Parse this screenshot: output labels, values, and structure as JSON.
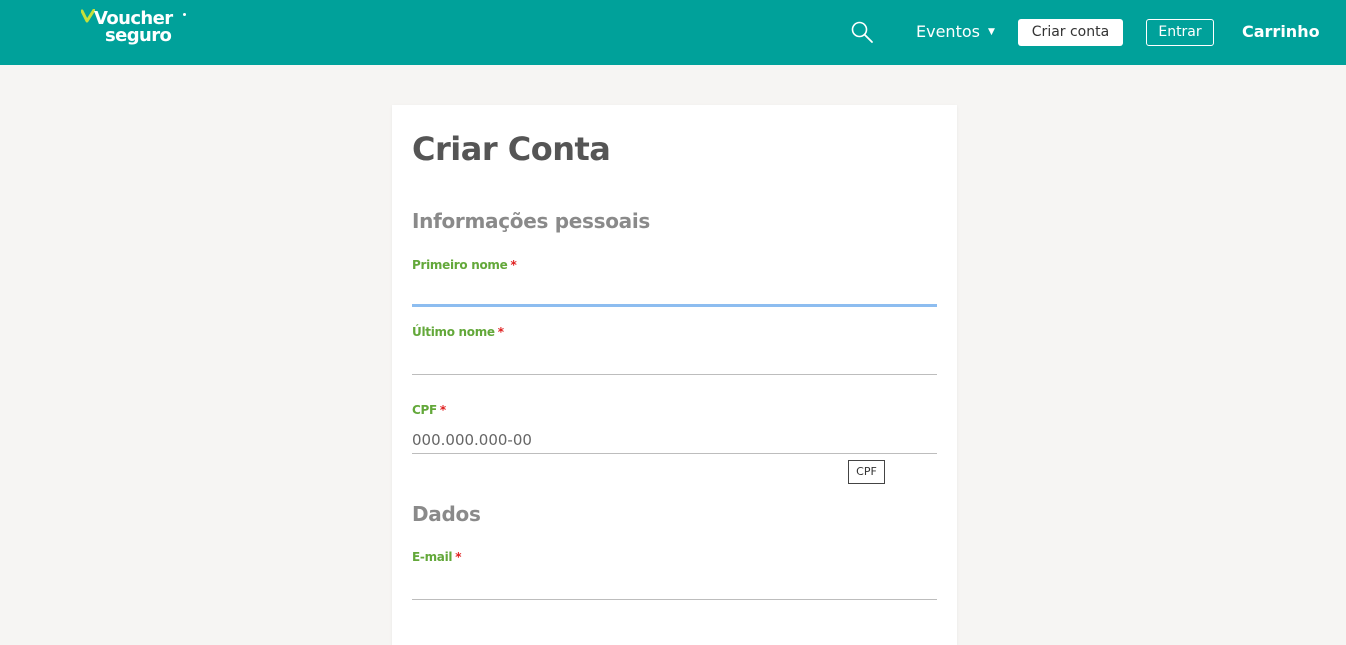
{
  "header": {
    "logo": {
      "line1": "Voucher",
      "line2": "seguro"
    },
    "nav": {
      "search_icon": "search-icon",
      "eventos_label": "Eventos",
      "eventos_caret": "▼",
      "criar_conta_label": "Criar conta",
      "entrar_label": "Entrar",
      "carrinho_label": "Carrinho"
    }
  },
  "form": {
    "title": "Criar Conta",
    "sections": {
      "personal": "Informações pessoais",
      "data": "Dados"
    },
    "fields": {
      "first_name": {
        "label": "Primeiro nome",
        "required_mark": "*",
        "value": ""
      },
      "last_name": {
        "label": "Último nome",
        "required_mark": "*",
        "value": ""
      },
      "cpf": {
        "label": "CPF",
        "required_mark": "*",
        "placeholder": "000.000.000-00",
        "badge": "CPF"
      },
      "email": {
        "label": "E-mail",
        "required_mark": "*",
        "value": ""
      }
    }
  },
  "colors": {
    "header_bg": "#00a19a",
    "label_green": "#63a83a",
    "required_red": "#e02020",
    "focus_blue": "#8dbdf0"
  }
}
